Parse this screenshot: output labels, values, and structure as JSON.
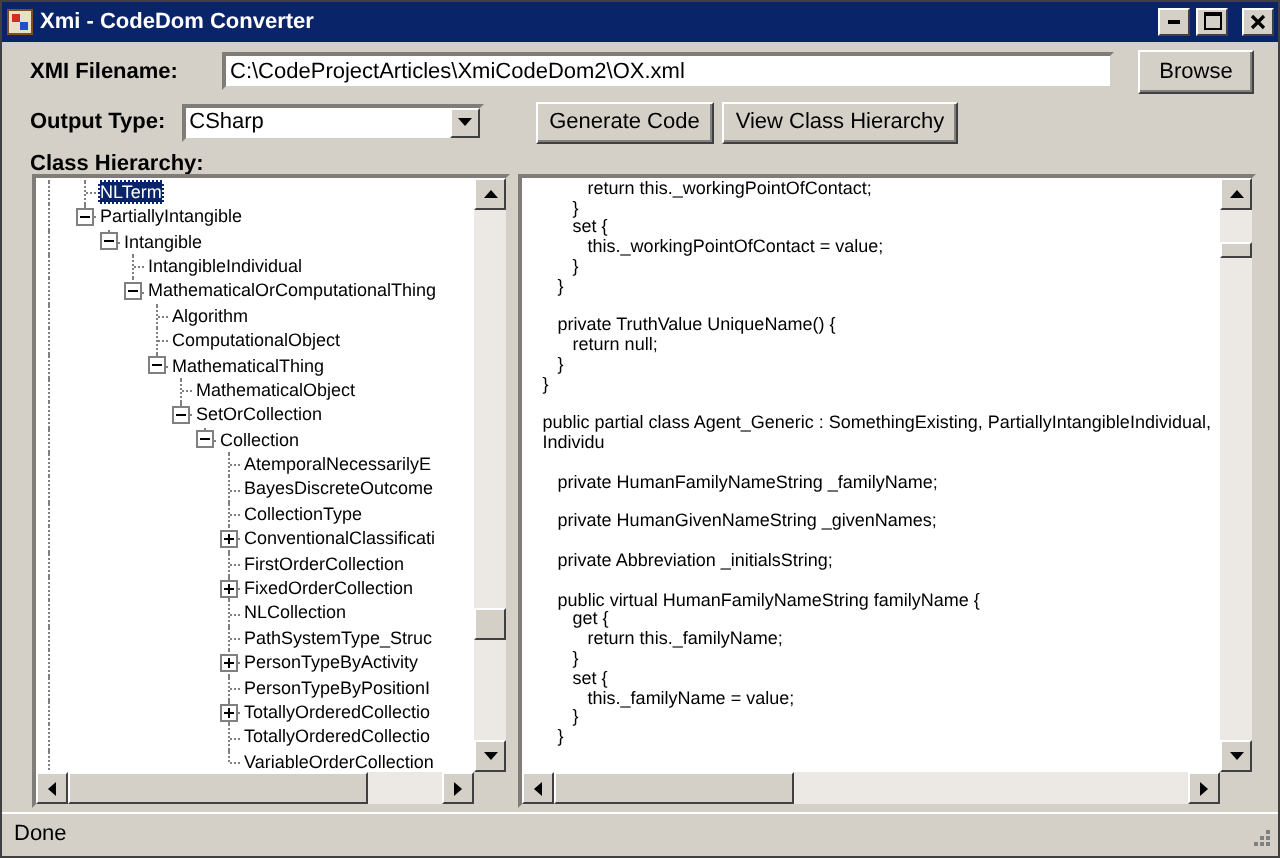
{
  "window": {
    "title": "Xmi - CodeDom Converter"
  },
  "xmi_filename": {
    "label": "XMI Filename:",
    "value": "C:\\CodeProjectArticles\\XmiCodeDom2\\OX.xml"
  },
  "browse_button": "Browse",
  "output_type": {
    "label": "Output Type:",
    "value": "CSharp"
  },
  "buttons": [
    "Generate Code",
    "View Class Hierarchy"
  ],
  "class_hierarchy": {
    "label": "Class Hierarchy:",
    "tree": [
      {
        "label": "NLTerm",
        "selected": true
      },
      {
        "label": "PartiallyIntangible",
        "selected": false,
        "expanded": true,
        "children": [
          {
            "label": "Intangible",
            "selected": false,
            "expanded": true,
            "children": [
              {
                "label": "IntangibleIndividual",
                "selected": false
              },
              {
                "label": "MathematicalOrComputationalThing",
                "selected": false,
                "expanded": true,
                "children": [
                  {
                    "label": "Algorithm",
                    "selected": false
                  },
                  {
                    "label": "ComputationalObject",
                    "selected": false
                  },
                  {
                    "label": "MathematicalThing",
                    "selected": false,
                    "expanded": true,
                    "children": [
                      {
                        "label": "MathematicalObject",
                        "selected": false
                      },
                      {
                        "label": "SetOrCollection",
                        "selected": false,
                        "expanded": true,
                        "children": [
                          {
                            "label": "Collection",
                            "selected": false,
                            "expanded": true,
                            "children": [
                              {
                                "label": "AtemporalNecessarilyE",
                                "selected": false
                              },
                              {
                                "label": "BayesDiscreteOutcome",
                                "selected": false
                              },
                              {
                                "label": "CollectionType",
                                "selected": false
                              },
                              {
                                "label": "ConventionalClassificati",
                                "selected": false,
                                "expanded": false
                              },
                              {
                                "label": "FirstOrderCollection",
                                "selected": false
                              },
                              {
                                "label": "FixedOrderCollection",
                                "selected": false,
                                "expanded": false
                              },
                              {
                                "label": "NLCollection",
                                "selected": false
                              },
                              {
                                "label": "PathSystemType_Struc",
                                "selected": false
                              },
                              {
                                "label": "PersonTypeByActivity",
                                "selected": false,
                                "expanded": false
                              },
                              {
                                "label": "PersonTypeByPositionI",
                                "selected": false
                              },
                              {
                                "label": "TotallyOrderedCollectio",
                                "selected": false,
                                "expanded": false
                              },
                              {
                                "label": "TotallyOrderedCollectio",
                                "selected": false
                              },
                              {
                                "label": "VariableOrderCollection",
                                "selected": false
                              }
                            ]
                          }
                        ]
                      }
                    ]
                  }
                ]
              }
            ]
          }
        ]
      }
    ]
  },
  "code": "         return this._workingPointOfContact;\n      }\n      set {\n         this._workingPointOfContact = value;\n      }\n   }\n\n   private TruthValue UniqueName() {\n      return null;\n   }\n}\n\npublic partial class Agent_Generic : SomethingExisting, PartiallyIntangibleIndividual, Individu\n\n   private HumanFamilyNameString _familyName;\n\n   private HumanGivenNameString _givenNames;\n\n   private Abbreviation _initialsString;\n\n   public virtual HumanFamilyNameString familyName {\n      get {\n         return this._familyName;\n      }\n      set {\n         this._familyName = value;\n      }\n   }",
  "status_bar": "Done"
}
